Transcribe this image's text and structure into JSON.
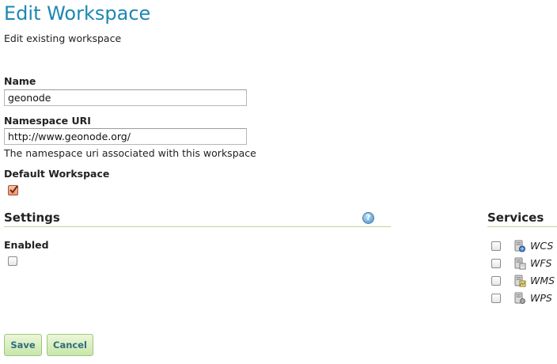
{
  "header": {
    "title": "Edit Workspace",
    "subtitle": "Edit existing workspace"
  },
  "form": {
    "name_label": "Name",
    "name_value": "geonode",
    "namespace_label": "Namespace URI",
    "namespace_value": "http://www.geonode.org/",
    "namespace_help": "The namespace uri associated with this workspace",
    "default_label": "Default Workspace",
    "default_checked": true
  },
  "settings": {
    "title": "Settings",
    "help_glyph": "?",
    "enabled_label": "Enabled",
    "enabled_checked": false
  },
  "services": {
    "title": "Services",
    "items": [
      {
        "label": "WCS",
        "checked": false,
        "icon": "wcs-service-icon"
      },
      {
        "label": "WFS",
        "checked": false,
        "icon": "wfs-service-icon"
      },
      {
        "label": "WMS",
        "checked": false,
        "icon": "wms-service-icon"
      },
      {
        "label": "WPS",
        "checked": false,
        "icon": "wps-service-icon"
      }
    ]
  },
  "actions": {
    "save_label": "Save",
    "cancel_label": "Cancel"
  },
  "colors": {
    "title": "#1c87b3",
    "section_rule": "#bed59a",
    "button_text": "#2f6e7e"
  }
}
